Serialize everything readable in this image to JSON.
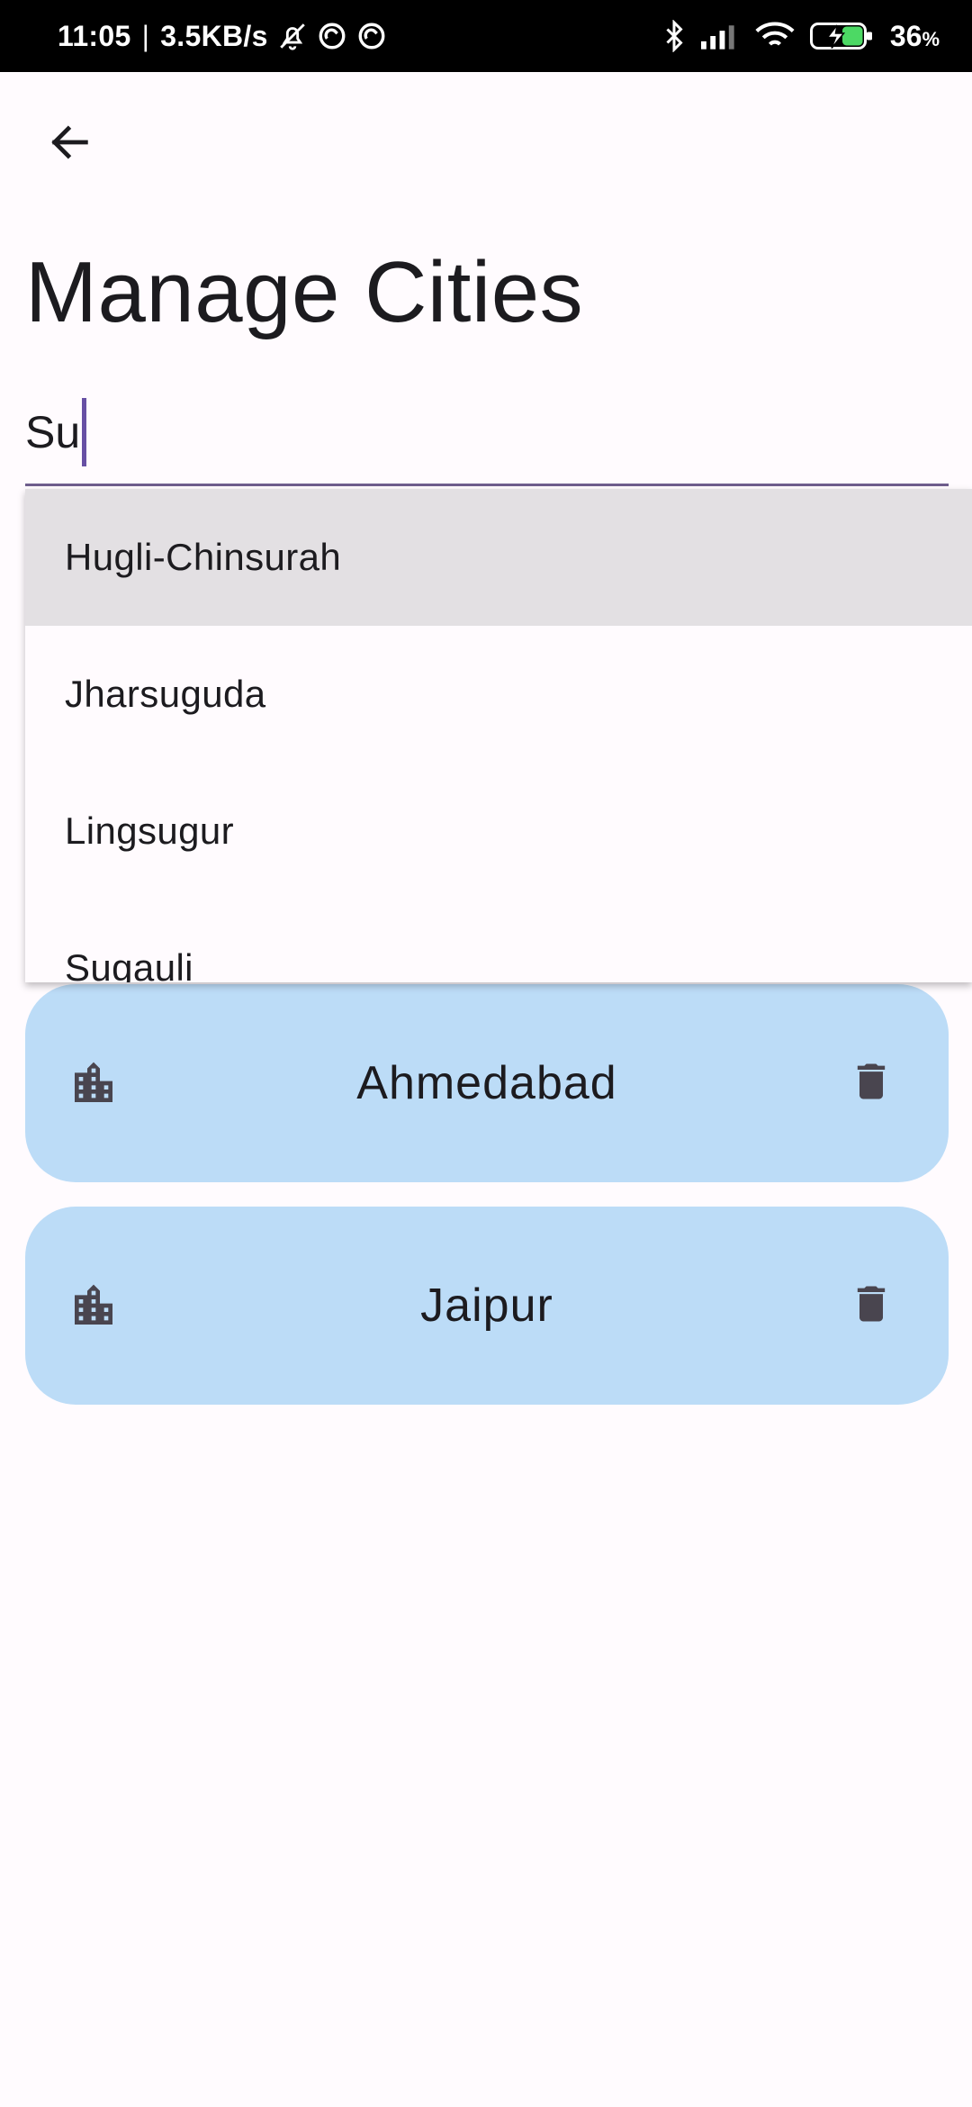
{
  "status_bar": {
    "time": "11:05",
    "separator": "|",
    "network_speed": "3.5KB/s",
    "battery_percent": "36",
    "battery_unit": "%",
    "icons": [
      "mute-icon",
      "sync-icon",
      "sync-icon",
      "bluetooth-icon",
      "signal-icon",
      "wifi-icon",
      "battery-charging-icon"
    ]
  },
  "header": {
    "back_icon": "arrow-left-icon",
    "title": "Manage Cities"
  },
  "search": {
    "value": "Su",
    "underline_color": "#6f5e8d",
    "caret_color": "#6750a4"
  },
  "suggestions": [
    {
      "label": "Hugli-Chinsurah",
      "highlighted": true
    },
    {
      "label": "Jharsuguda",
      "highlighted": false
    },
    {
      "label": "Lingsugur",
      "highlighted": false
    },
    {
      "label": "Sugauli",
      "highlighted": false
    }
  ],
  "cities": [
    {
      "name": "Ahmedabad",
      "icon": "city-icon",
      "action_icon": "delete-icon"
    },
    {
      "name": "Jaipur",
      "icon": "city-icon",
      "action_icon": "delete-icon"
    }
  ],
  "colors": {
    "card_background": "#bcdcf7",
    "page_background": "#fffbfe",
    "highlight_background": "#e3e0e3",
    "icon_color": "#49454f"
  }
}
